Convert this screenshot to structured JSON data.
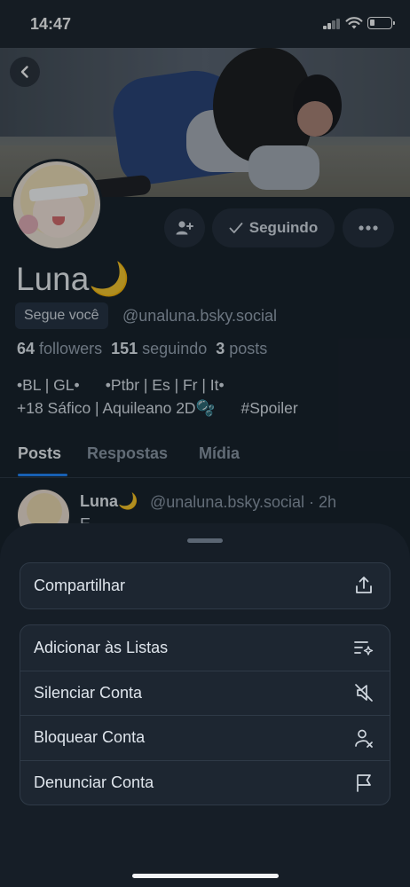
{
  "status_bar": {
    "time": "14:47"
  },
  "profile": {
    "display_name": "Luna🌙",
    "follows_you_badge": "Segue você",
    "handle": "@unaluna.bsky.social",
    "followers_count": "64",
    "followers_label": "followers",
    "following_count": "151",
    "following_label": "seguindo",
    "posts_count": "3",
    "posts_label": "posts",
    "bio_line1": "•BL | GL•      •Ptbr | Es | Fr | It•",
    "bio_line2": "+18 Sáfico | Aquileano 2D🫧      #Spoiler"
  },
  "actions": {
    "add_icon": "person-add-icon",
    "following_label": "Seguindo",
    "more_icon": "more-horizontal-icon"
  },
  "tabs": [
    {
      "label": "Posts",
      "active": true
    },
    {
      "label": "Respostas",
      "active": false
    },
    {
      "label": "Mídia",
      "active": false
    }
  ],
  "post_preview": {
    "author": "Luna🌙",
    "meta": "@unaluna.bsky.social · 2h",
    "text": "E"
  },
  "sheet": {
    "share": {
      "label": "Compartilhar",
      "icon": "share-icon"
    },
    "items": [
      {
        "label": "Adicionar às Listas",
        "icon": "list-add-icon"
      },
      {
        "label": "Silenciar Conta",
        "icon": "speaker-mute-icon"
      },
      {
        "label": "Bloquear Conta",
        "icon": "person-block-icon"
      },
      {
        "label": "Denunciar Conta",
        "icon": "flag-icon"
      }
    ]
  },
  "colors": {
    "background": "#161e27",
    "accent": "#1f86ff",
    "muted_text": "#9aa6b4"
  }
}
